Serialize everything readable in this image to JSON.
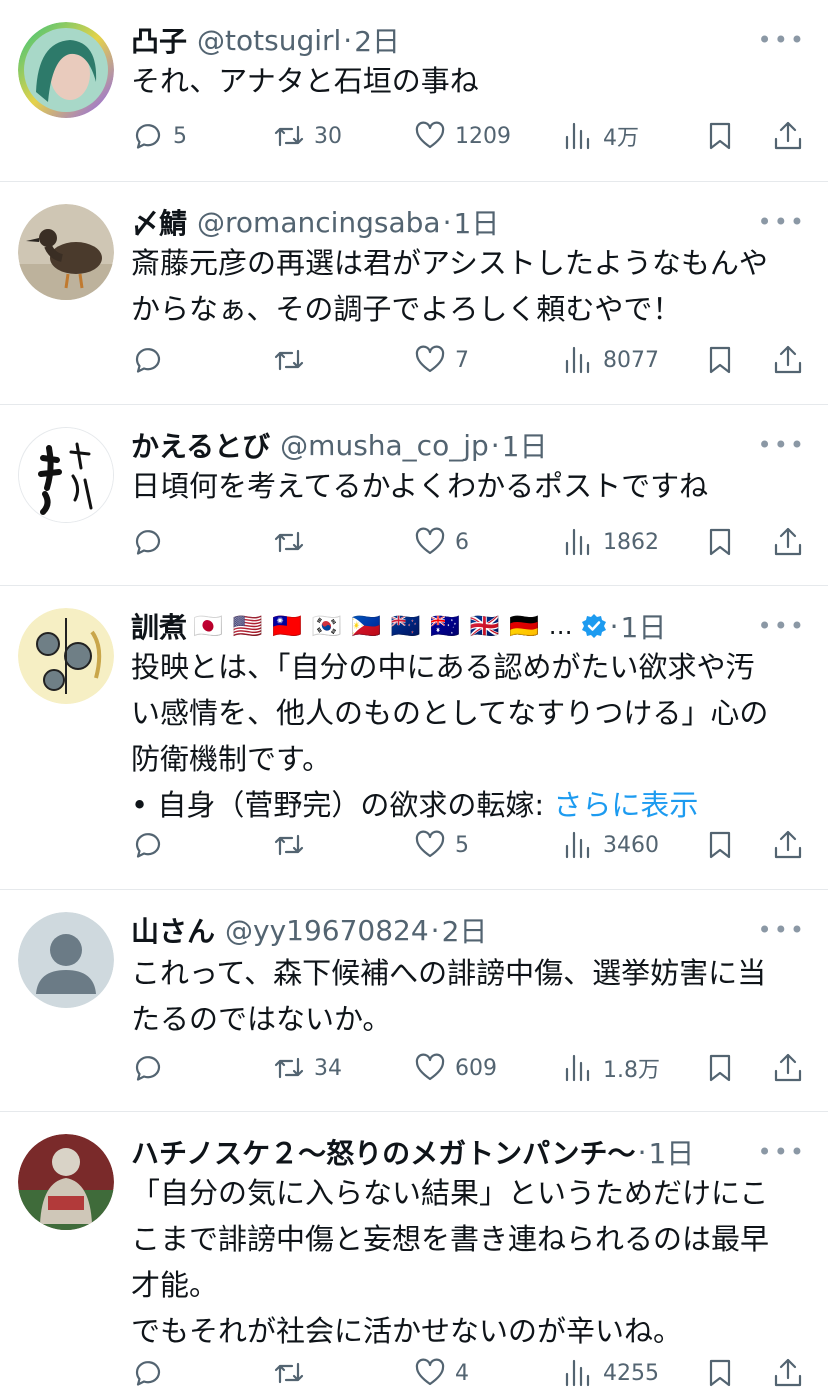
{
  "more_label": "•••",
  "show_more": "さらに表示",
  "tweets": [
    {
      "name": "凸子",
      "handle": "@totsugirl",
      "time": "2日",
      "avatar": "avatar-woman-photo",
      "lines": [
        "それ、アナタと石垣の事ね"
      ],
      "replies": "5",
      "retweets": "30",
      "likes": "1209",
      "views": "4万"
    },
    {
      "name": "〆鯖",
      "handle": "@romancingsaba",
      "time": "1日",
      "avatar": "avatar-duck-photo",
      "lines": [
        "斎藤元彦の再選は君がアシストしたようなもんや",
        "からなぁ、その調子でよろしく頼むやで！"
      ],
      "replies": "",
      "retweets": "",
      "likes": "7",
      "views": "8077"
    },
    {
      "name": "かえるとび",
      "handle": "@musha_co_jp",
      "time": "1日",
      "avatar": "avatar-calligraphy",
      "lines": [
        "日頃何を考えてるかよくわかるポストですね"
      ],
      "replies": "",
      "retweets": "",
      "likes": "6",
      "views": "1862"
    },
    {
      "name": "訓煮",
      "flags": "🇯🇵 🇺🇸 🇹🇼 🇰🇷 🇵🇭 🇳🇿 🇦🇺 🇬🇧 🇩🇪 …",
      "verified": true,
      "handle": "",
      "time": "1日",
      "avatar": "avatar-cartoon",
      "lines": [
        "投映とは、「自分の中にある認めがたい欲求や汚",
        "い感情を、他人のものとしてなすりつける」心の",
        "防衛機制です。",
        "• 自身（菅野完）の欲求の転嫁: "
      ],
      "replies": "",
      "retweets": "",
      "likes": "5",
      "views": "3460"
    },
    {
      "name": "山さん",
      "handle": "@yy19670824",
      "time": "2日",
      "avatar": "avatar-default",
      "lines": [
        "これって、森下候補への誹謗中傷、選挙妨害に当",
        "たるのではないか。"
      ],
      "replies": "",
      "retweets": "34",
      "likes": "609",
      "views": "1.8万"
    },
    {
      "name": "ハチノスケ２〜怒りのメガトンパンチ〜",
      "handle": "",
      "time": "1日",
      "avatar": "avatar-wrestler-photo",
      "lines": [
        "「自分の気に入らない結果」というためだけにこ",
        "こまで誹謗中傷と妄想を書き連ねられるのは最早",
        "才能。",
        "でもそれが社会に活かせないのが辛いね。"
      ],
      "replies": "",
      "retweets": "",
      "likes": "4",
      "views": "4255"
    }
  ]
}
